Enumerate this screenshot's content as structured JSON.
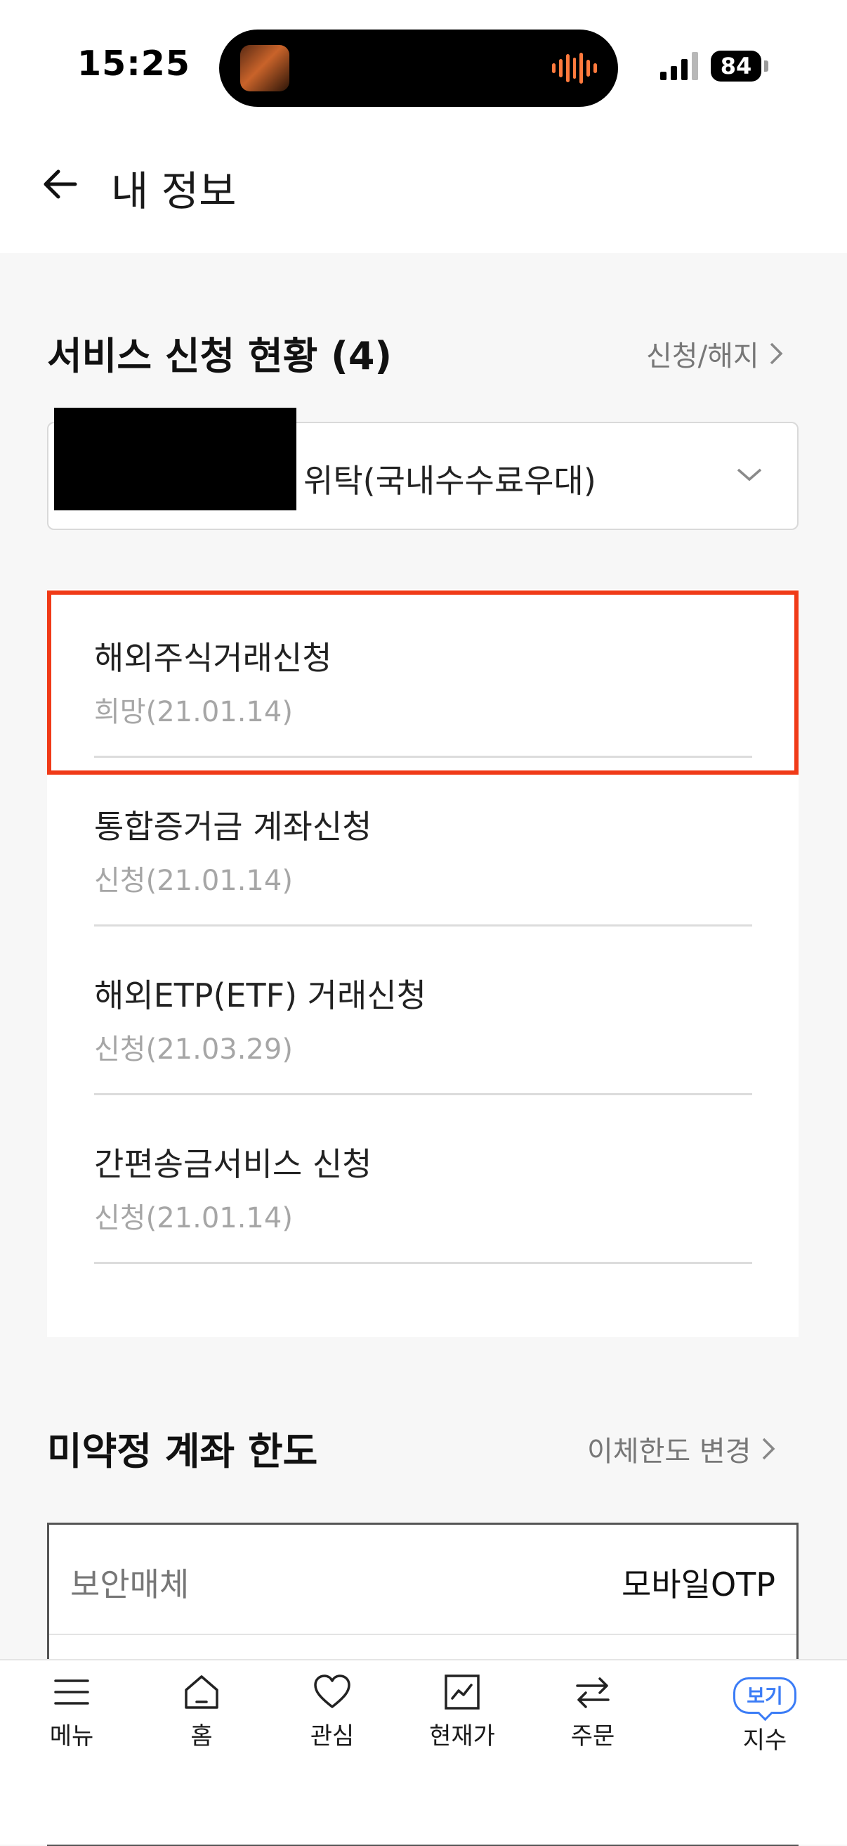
{
  "status_bar": {
    "time": "15:25",
    "battery": "84"
  },
  "header": {
    "title": "내 정보"
  },
  "service_section": {
    "title": "서비스 신청 현황 (4)",
    "link_label": "신청/해지",
    "account_label": "위탁(국내수수료우대)",
    "items": [
      {
        "title": "해외주식거래신청",
        "status": "희망(21.01.14)"
      },
      {
        "title": "통합증거금 계좌신청",
        "status": "신청(21.01.14)"
      },
      {
        "title": "해외ETP(ETF) 거래신청",
        "status": "신청(21.03.29)"
      },
      {
        "title": "간편송금서비스 신청",
        "status": "신청(21.01.14)"
      }
    ]
  },
  "limit_section": {
    "title": "미약정 계좌 한도",
    "link_label": "이체한도 변경",
    "rows": [
      {
        "label": "보안매체",
        "value": "모바일OTP"
      }
    ]
  },
  "tab_bar": {
    "items": [
      {
        "label": "메뉴",
        "icon": "menu-icon"
      },
      {
        "label": "홈",
        "icon": "home-icon"
      },
      {
        "label": "관심",
        "icon": "heart-icon"
      },
      {
        "label": "현재가",
        "icon": "chart-icon"
      },
      {
        "label": "주문",
        "icon": "exchange-icon"
      },
      {
        "label": "지수",
        "icon": "view-badge",
        "badge": "보기"
      }
    ]
  },
  "colors": {
    "highlight": "#f03a17",
    "accent": "#3b7cf6"
  }
}
